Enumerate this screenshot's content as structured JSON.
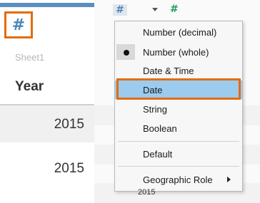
{
  "grid": {
    "type_icon": "#",
    "sheet_label": "Sheet1",
    "column_header": "Year",
    "rows": [
      "2015",
      "2015"
    ]
  },
  "header_bar": {
    "data_type_icon": "#",
    "second_type_icon": "#"
  },
  "menu": {
    "items": [
      {
        "label": "Number (decimal)"
      },
      {
        "label": "Number (whole)",
        "selected": true
      },
      {
        "label": "Date & Time"
      },
      {
        "label": "Date",
        "hovered": true
      },
      {
        "label": "String"
      },
      {
        "label": "Boolean"
      },
      {
        "label": "Default"
      },
      {
        "label": "Geographic Role",
        "has_submenu": true
      }
    ]
  },
  "peek": {
    "bottom_text": "2015"
  },
  "colors": {
    "accent_orange": "#e36c0a",
    "highlight_blue": "#9ccbf0",
    "type_icon_blue": "#4d86b8",
    "type_icon_green": "#1f9c63"
  }
}
